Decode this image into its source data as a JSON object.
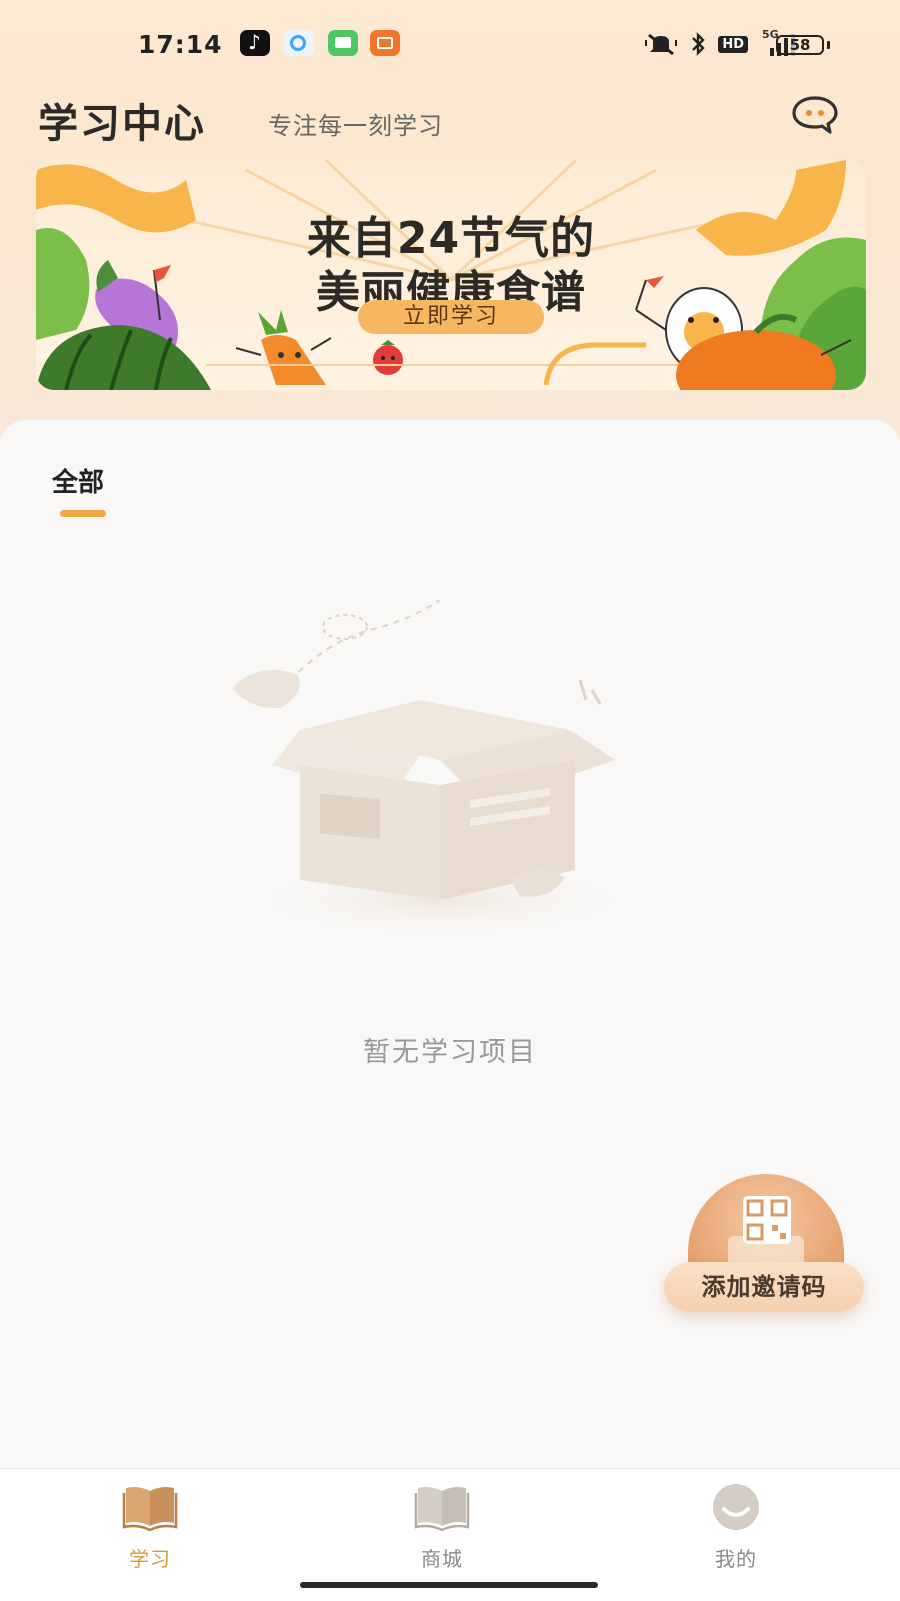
{
  "status_bar": {
    "time": "17:14",
    "network": "5G",
    "hd_badge": "HD",
    "battery": "58",
    "app_icons": [
      "tiktok-icon",
      "qq-browser-icon",
      "messages-icon",
      "reader-icon"
    ]
  },
  "header": {
    "title": "学习中心",
    "subtitle": "专注每一刻学习",
    "chat_icon": "chat-bubble-icon"
  },
  "banner": {
    "line1": "来自24节气的",
    "line2": "美丽健康食谱",
    "cta": "立即学习"
  },
  "tabs": [
    {
      "label": "全部",
      "active": true
    }
  ],
  "empty_state": {
    "text": "暂无学习项目",
    "icon": "empty-box-icon"
  },
  "invite": {
    "label": "添加邀请码",
    "icon": "qr-code-icon"
  },
  "bottom_nav": {
    "items": [
      {
        "label": "学习",
        "icon": "book-icon",
        "active": true
      },
      {
        "label": "商城",
        "icon": "book-icon",
        "active": false
      },
      {
        "label": "我的",
        "icon": "profile-icon",
        "active": false
      }
    ]
  },
  "colors": {
    "accent": "#f3a444",
    "active_nav": "#d99845",
    "header_bg": "#fde9d3",
    "banner_cta": "#f6b760"
  }
}
